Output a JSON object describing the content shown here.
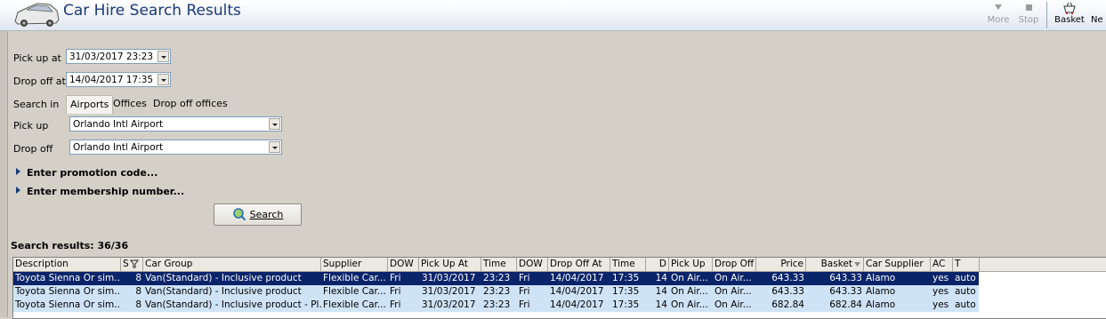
{
  "header": {
    "title": "Car Hire Search Results",
    "toolbar": {
      "more_label": "More",
      "stop_label": "Stop",
      "basket_label": "Basket",
      "next_label": "Ne"
    }
  },
  "form": {
    "pickup_at_label": "Pick up at",
    "pickup_at_value": "31/03/2017 23:23",
    "dropoff_at_label": "Drop off at",
    "dropoff_at_value": "14/04/2017 17:35",
    "search_in_label": "Search in",
    "tabs": [
      "Airports",
      "Offices",
      "Drop off offices"
    ],
    "pickup_label": "Pick up",
    "pickup_value": "Orlando Intl Airport",
    "dropoff_label": "Drop off",
    "dropoff_value": "Orlando Intl Airport",
    "promo_label": "Enter promotion code...",
    "membership_label": "Enter membership number...",
    "search_button": "Search"
  },
  "results": {
    "label": "Search results: 36/36",
    "columns": [
      "Description",
      "S",
      "Car Group",
      "Supplier",
      "DOW",
      "Pick Up At",
      "Time",
      "DOW",
      "Drop Off At",
      "Time",
      "D",
      "Pick Up",
      "Drop Off",
      "Price",
      "Basket",
      "Car Supplier",
      "AC",
      "T"
    ],
    "rows": [
      [
        "Toyota Sienna Or sim...",
        "8",
        "Van(Standard) - Inclusive product",
        "Flexible Car...",
        "Fri",
        "31/03/2017",
        "23:23",
        "Fri",
        "14/04/2017",
        "17:35",
        "14",
        "On Air...",
        "On Air...",
        "643.33",
        "643.33",
        "Alamo",
        "yes",
        "auto"
      ],
      [
        "Toyota Sienna Or sim...",
        "8",
        "Van(Standard) - Inclusive product",
        "Flexible Car...",
        "Fri",
        "31/03/2017",
        "23:23",
        "Fri",
        "14/04/2017",
        "17:35",
        "14",
        "On Air...",
        "On Air...",
        "643.33",
        "643.33",
        "Alamo",
        "yes",
        "auto"
      ],
      [
        "Toyota Sienna Or sim...",
        "8",
        "Van(Standard) - Inclusive product - Pl...",
        "Flexible Car...",
        "Fri",
        "31/03/2017",
        "23:23",
        "Fri",
        "14/04/2017",
        "17:35",
        "14",
        "On Air...",
        "On Air...",
        "682.84",
        "682.84",
        "Alamo",
        "yes",
        "auto"
      ]
    ]
  },
  "colors": {
    "title": "#1b3a78",
    "selected_row": "#0a246a",
    "row_bg": "#cfe3f7",
    "panel_bg": "#d4d0c8"
  }
}
